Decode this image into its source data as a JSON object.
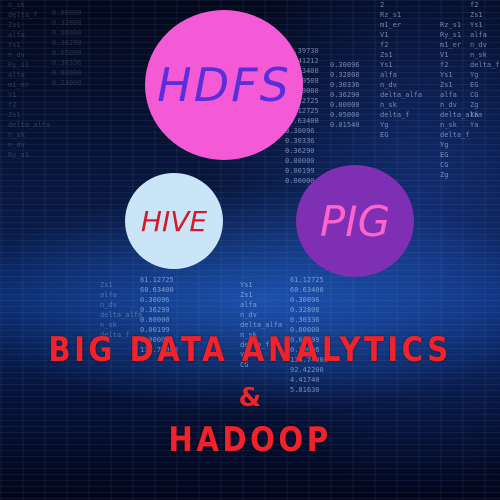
{
  "background": {
    "colors": {
      "base": "#050a1c",
      "glow": "#286edc"
    }
  },
  "bubbles": {
    "hdfs": {
      "label": "HDFS",
      "fill": "#f55ad6",
      "text_color": "#5a2fd9"
    },
    "hive": {
      "label": "HIVE",
      "fill": "#c9e5f7",
      "text_color": "#d51a2a"
    },
    "pig": {
      "label": "PIG",
      "fill": "#7e2fb4",
      "text_color": "#ff64cc"
    }
  },
  "title": {
    "line1": "BIG DATA ANALYTICS",
    "line2": "&",
    "line3": "HADOOP",
    "color": "#f0232b"
  }
}
